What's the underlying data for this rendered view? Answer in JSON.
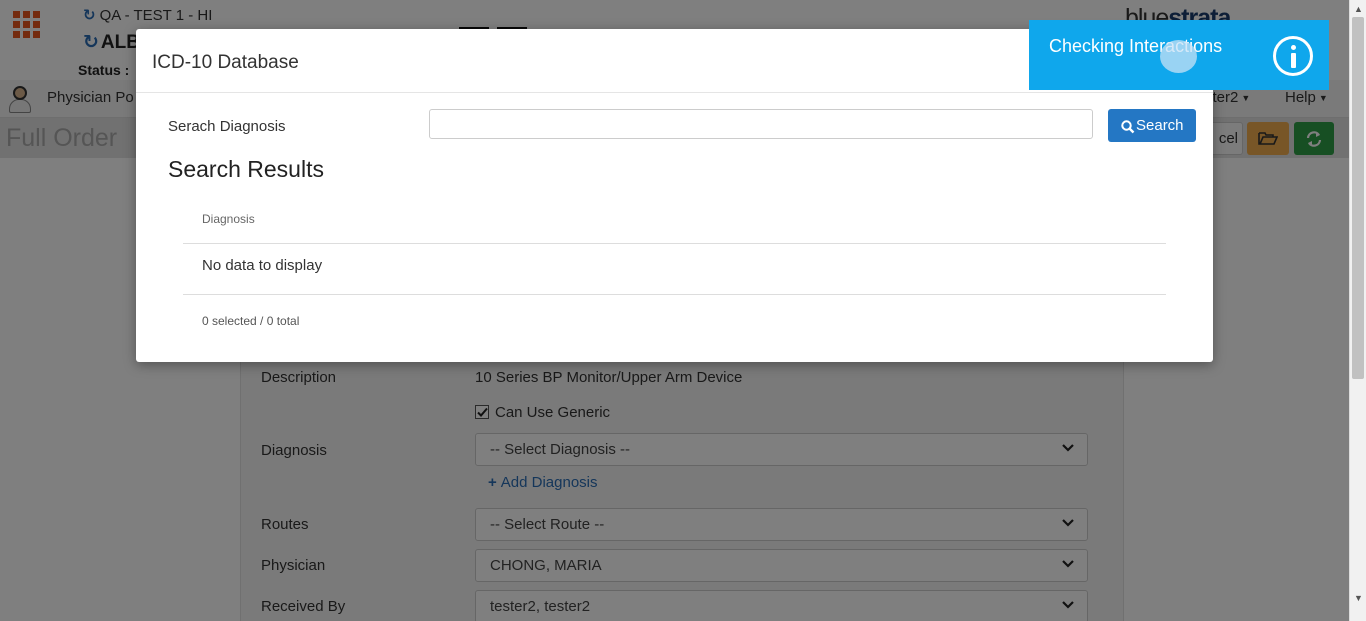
{
  "header": {
    "facility": "QA - TEST 1 - HI",
    "patient_fragment": "ALB",
    "status_label": "Status :",
    "logo_a": "blue",
    "logo_b": "strata"
  },
  "navbar": {
    "module": "Physician Po",
    "user_fragment": "ster2",
    "help": "Help"
  },
  "titlebar": {
    "title": "Full Order",
    "cancel_fragment": "cel"
  },
  "form": {
    "description_label": "Description",
    "description_value": "10 Series BP Monitor/Upper Arm Device",
    "generic_label": "Can Use Generic",
    "generic_checked": true,
    "diagnosis_label": "Diagnosis",
    "diagnosis_value": "-- Select Diagnosis --",
    "add_diagnosis": "Add Diagnosis",
    "routes_label": "Routes",
    "routes_value": "-- Select Route --",
    "physician_label": "Physician",
    "physician_value": "CHONG, MARIA",
    "received_label": "Received By",
    "received_value": "tester2, tester2"
  },
  "modal": {
    "title": "ICD-10 Database",
    "search_label": "Serach Diagnosis",
    "search_value": "",
    "search_button": "Search",
    "results_title": "Search Results",
    "grid": {
      "columns": [
        "Diagnosis"
      ],
      "rows": [],
      "empty_text": "No data to display",
      "footer": "0 selected / 0 total"
    }
  },
  "toast": {
    "message": "Checking Interactions",
    "icon": "info-icon"
  },
  "colors": {
    "toast_bg": "#0fa7ec",
    "primary": "#2477c4",
    "warning": "#f0ad4e",
    "success": "#2e9e46",
    "apps_icon": "#e8571e"
  }
}
